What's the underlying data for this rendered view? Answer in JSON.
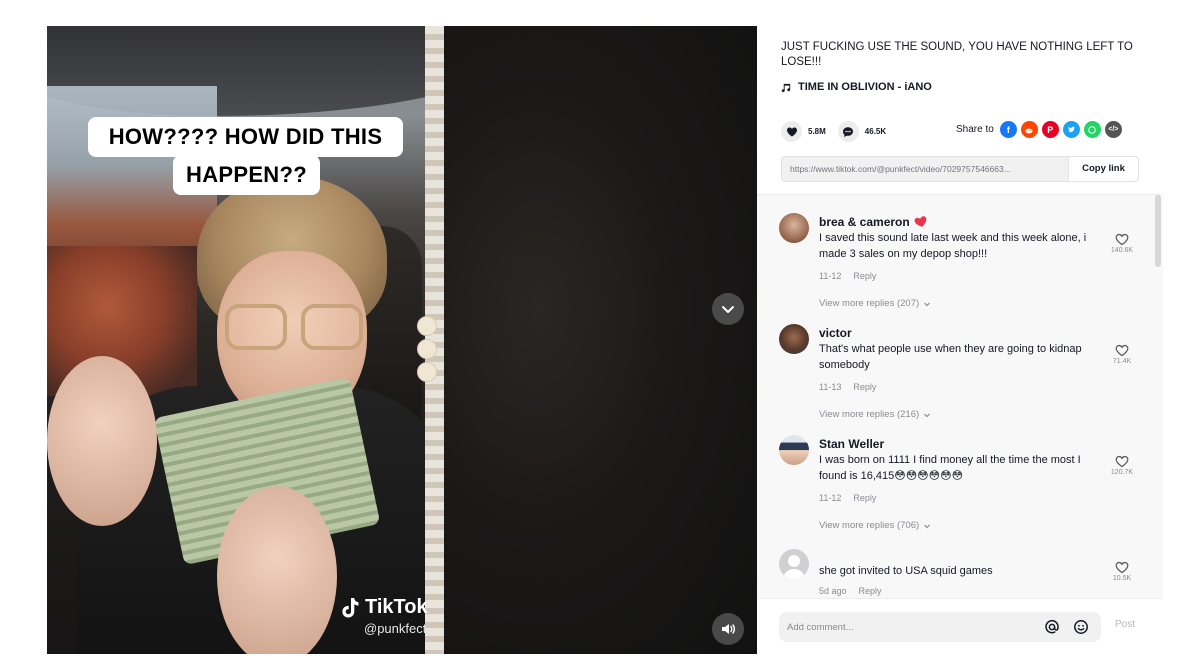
{
  "video": {
    "caption_line1": "HOW???? HOW DID THIS",
    "caption_line2": "HAPPEN??",
    "watermark_logo": "TikTok",
    "watermark_handle": "@punkfect"
  },
  "post": {
    "description": "JUST FUCKING USE THE SOUND, YOU HAVE NOTHING LEFT TO LOSE!!!",
    "music": "TIME IN OBLIVION - iANO",
    "likes": "5.8M",
    "comments": "46.5K",
    "share_label": "Share to",
    "share_icons": [
      {
        "name": "facebook-icon",
        "color": "#1877f2",
        "glyph": "f"
      },
      {
        "name": "reddit-icon",
        "color": "#ff4500",
        "glyph": "r"
      },
      {
        "name": "pinterest-icon",
        "color": "#e60023",
        "glyph": "p"
      },
      {
        "name": "twitter-icon",
        "color": "#1da1f2",
        "glyph": "t"
      },
      {
        "name": "whatsapp-icon",
        "color": "#25d366",
        "glyph": "w"
      },
      {
        "name": "embed-icon",
        "color": "#555555",
        "glyph": "</>"
      }
    ],
    "link": "https://www.tiktok.com/@punkfect/video/7029757546663...",
    "copy_link_label": "Copy link"
  },
  "comments": [
    {
      "user": "brea & cameron",
      "badge": "heart",
      "text": "I saved this sound late last week and this week alone, i made 3 sales on my depop shop!!!",
      "date": "11-12",
      "reply_label": "Reply",
      "more_replies": "View more replies (207)",
      "likes": "140.6K"
    },
    {
      "user": "victor",
      "text": "That's what people use when they are going to kidnap somebody",
      "date": "11-13",
      "reply_label": "Reply",
      "more_replies": "View more replies (216)",
      "likes": "71.4K"
    },
    {
      "user": "Stan Weller",
      "text": "I was born on 1111 I find money all the time the most I found is 16,415😳😳😳😳😳😳",
      "date": "11-12",
      "reply_label": "Reply",
      "more_replies": "View more replies (706)",
      "likes": "120.7K"
    },
    {
      "user": "",
      "text": "she got invited to USA squid games",
      "date": "5d ago",
      "reply_label": "Reply",
      "likes": "10.5K"
    }
  ],
  "comment_bar": {
    "placeholder": "Add comment...",
    "post_label": "Post"
  },
  "colors": {
    "accent": "#fe2c55",
    "text": "#161823",
    "muted": "#8a8b91"
  }
}
